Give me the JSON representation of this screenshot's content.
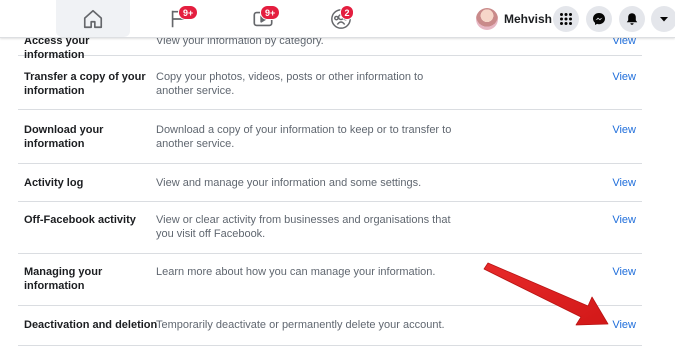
{
  "topbar": {
    "tabs": [
      {
        "name": "home",
        "icon": "home-icon",
        "badge": ""
      },
      {
        "name": "pages",
        "icon": "flag-icon",
        "badge": "9+"
      },
      {
        "name": "watch",
        "icon": "video-icon",
        "badge": "9+"
      },
      {
        "name": "groups",
        "icon": "groups-icon",
        "badge": "2"
      }
    ],
    "profile_name": "Mehvish",
    "buttons": [
      "menu-grid-icon",
      "messenger-icon",
      "bell-icon",
      "caret-down-icon"
    ]
  },
  "rows": [
    {
      "title": "Access your information",
      "description": "View your information by category.",
      "link": "View"
    },
    {
      "title": "Transfer a copy of your information",
      "description": "Copy your photos, videos, posts or other information to another service.",
      "link": "View"
    },
    {
      "title": "Download your information",
      "description": "Download a copy of your information to keep or to transfer to another service.",
      "link": "View"
    },
    {
      "title": "Activity log",
      "description": "View and manage your information and some settings.",
      "link": "View"
    },
    {
      "title": "Off-Facebook activity",
      "description": "View or clear activity from businesses and organisations that you visit off Facebook.",
      "link": "View"
    },
    {
      "title": "Managing your information",
      "description": "Learn more about how you can manage your information.",
      "link": "View"
    },
    {
      "title": "Deactivation and deletion",
      "description": "Temporarily deactivate or permanently delete your account.",
      "link": "View"
    }
  ],
  "colors": {
    "link": "#216fdb",
    "badge": "#e41e3f",
    "annotation_arrow": "#e41e2a"
  }
}
